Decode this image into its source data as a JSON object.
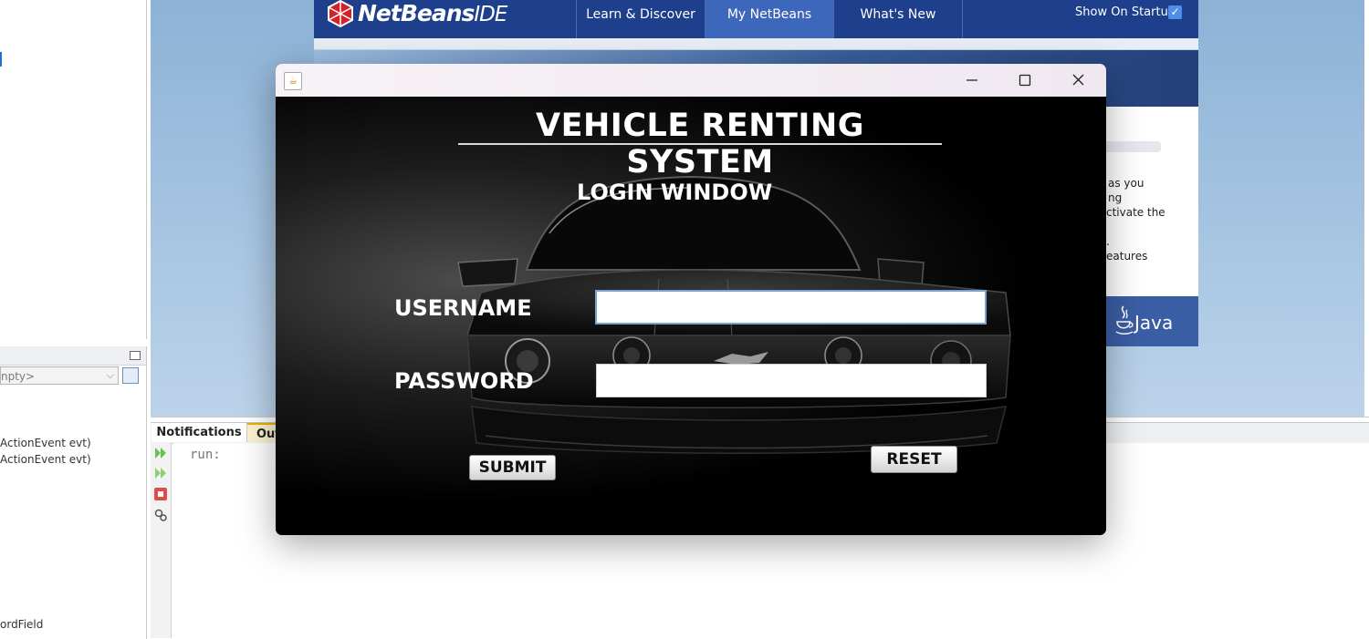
{
  "ide": {
    "navigator": {
      "combo_value": "npty>",
      "members": [
        "ActionEvent evt)",
        "ActionEvent evt)"
      ],
      "bottom_member": "ordField"
    },
    "start_page": {
      "logo_text": "NetBeans",
      "logo_suffix": "IDE",
      "tabs": [
        "Learn & Discover",
        "My NetBeans",
        "What's New"
      ],
      "active_tab": "My NetBeans",
      "show_on_startup_label": "Show On Startup",
      "show_on_startup_checked": true,
      "partial_lines": [
        "as you",
        "ng",
        "ctivate the",
        ".",
        "eatures"
      ],
      "java_logo": "Java"
    },
    "output": {
      "tabs": [
        "Notifications",
        "Out"
      ],
      "active_tab": "Out",
      "text": "run:"
    }
  },
  "dialog": {
    "title": "",
    "app_title": "VEHICLE RENTING SYSTEM",
    "subtitle": "LOGIN WINDOW",
    "username_label": "USERNAME",
    "password_label": "PASSWORD",
    "username_value": "",
    "password_value": "",
    "submit_label": "SUBMIT",
    "reset_label": "RESET",
    "icons": {
      "app": "java-cup-icon",
      "minimize": "minimize-icon",
      "maximize": "maximize-icon",
      "close": "close-icon"
    }
  },
  "colors": {
    "netbeans_header": "#1e3f8c",
    "netbeans_active_tab": "#3d67ba",
    "dialog_background": "#000000",
    "dialog_text": "#ffffff",
    "checkbox_accent": "#4f8fe8"
  }
}
